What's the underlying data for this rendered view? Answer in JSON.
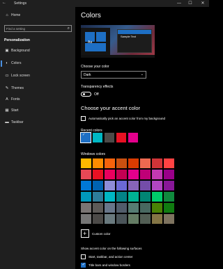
{
  "titlebar": {
    "back_glyph": "←",
    "title": "Settings",
    "minimize_glyph": "—",
    "maximize_glyph": "☐",
    "close_glyph": "✕"
  },
  "sidebar": {
    "home": {
      "icon": "home-icon",
      "glyph": "⌂",
      "label": "Home"
    },
    "search": {
      "placeholder": "Find a setting",
      "icon": "search-icon"
    },
    "section": "Personalization",
    "items": [
      {
        "icon": "picture-icon",
        "glyph": "▣",
        "label": "Background"
      },
      {
        "icon": "palette-icon",
        "glyph": "◐",
        "label": "Colors",
        "active": true
      },
      {
        "icon": "monitor-icon",
        "glyph": "▭",
        "label": "Lock screen"
      },
      {
        "icon": "brush-icon",
        "glyph": "✎",
        "label": "Themes"
      },
      {
        "icon": "font-icon",
        "glyph": "A",
        "label": "Fonts"
      },
      {
        "icon": "start-icon",
        "glyph": "▦",
        "label": "Start"
      },
      {
        "icon": "taskbar-icon",
        "glyph": "▬",
        "label": "Taskbar"
      }
    ],
    "accent": "#4a90e2"
  },
  "main": {
    "title": "Colors",
    "preview": {
      "sample_text": "Sample Text",
      "tile_text": "Aa"
    },
    "choose_color_label": "Choose your color",
    "choose_color_value": "Dark",
    "transparency_label": "Transparency effects",
    "transparency_state": "Off",
    "accent_heading": "Choose your accent color",
    "auto_pick_label": "Automatically pick an accent color from my background",
    "recent_label": "Recent colors",
    "recent_colors": [
      "#1e6fc4",
      "#00b7c3",
      "#4c4a48",
      "#e81123",
      "#e3008c"
    ],
    "windows_colors_label": "Windows colors",
    "windows_colors": [
      [
        "#ffb900",
        "#ff8c00",
        "#f7630c",
        "#ca5010",
        "#da3b01",
        "#ef6950",
        "#d13438",
        "#ff4343"
      ],
      [
        "#e74856",
        "#e81123",
        "#ea005e",
        "#c30052",
        "#e3008c",
        "#bf0077",
        "#c239b3",
        "#9a0089"
      ],
      [
        "#0078d7",
        "#0063b1",
        "#8e8cd8",
        "#6b69d6",
        "#8764b8",
        "#744da9",
        "#b146c2",
        "#881798"
      ],
      [
        "#0099bc",
        "#2d7d9a",
        "#00b7c3",
        "#038387",
        "#00b294",
        "#018574",
        "#00cc6a",
        "#10893e"
      ],
      [
        "#7a7574",
        "#5d5a58",
        "#68768a",
        "#515c6b",
        "#567c73",
        "#486860",
        "#498205",
        "#107c10"
      ],
      [
        "#767676",
        "#4c4a48",
        "#69797e",
        "#4a5459",
        "#647c64",
        "#525e54",
        "#847545",
        "#7e735f"
      ]
    ],
    "custom_color_label": "Custom color",
    "surfaces_label": "Show accent color on the following surfaces",
    "surface_start_label": "Start, taskbar, and action center",
    "surface_titlebars_label": "Title bars and window borders"
  }
}
